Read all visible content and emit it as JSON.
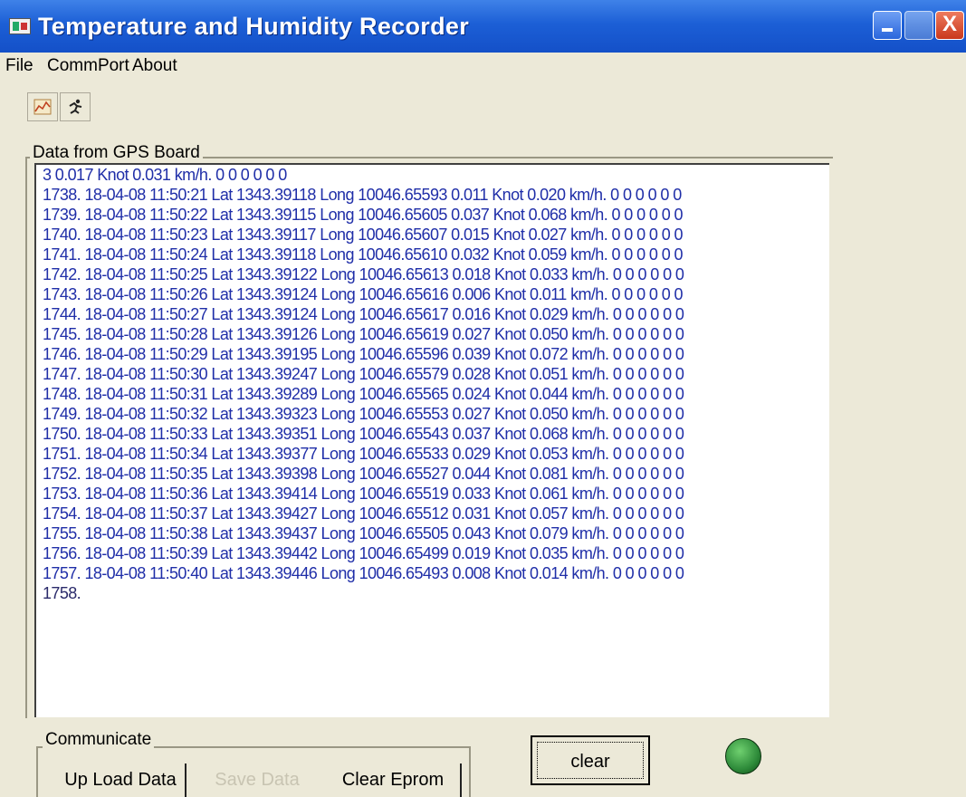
{
  "window": {
    "title": "Temperature and Humidity Recorder",
    "controls": {
      "minimize": "_",
      "maximize": "□",
      "close": "X"
    }
  },
  "menu": {
    "items": [
      {
        "label": "File"
      },
      {
        "label": "CommPort"
      },
      {
        "label": "About"
      }
    ]
  },
  "toolbar": {
    "buttons": [
      {
        "icon": "chart-icon"
      },
      {
        "icon": "runner-icon"
      }
    ]
  },
  "gps_group": {
    "label": "Data from GPS  Board",
    "log_lines": [
      "3  0.017 Knot 0.031 km/h. 0 0 0 0 0 0",
      "1738. 18-04-08 11:50:21 Lat 1343.39118 Long 10046.65593  0.011 Knot 0.020 km/h. 0 0 0 0 0 0",
      "1739. 18-04-08 11:50:22 Lat 1343.39115 Long 10046.65605  0.037 Knot 0.068 km/h. 0 0 0 0 0 0",
      "1740. 18-04-08 11:50:23 Lat 1343.39117 Long 10046.65607  0.015 Knot 0.027 km/h. 0 0 0 0 0 0",
      "1741. 18-04-08 11:50:24 Lat 1343.39118 Long 10046.65610  0.032 Knot 0.059 km/h. 0 0 0 0 0 0",
      "1742. 18-04-08 11:50:25 Lat 1343.39122 Long 10046.65613  0.018 Knot 0.033 km/h. 0 0 0 0 0 0",
      "1743. 18-04-08 11:50:26 Lat 1343.39124 Long 10046.65616  0.006 Knot 0.011 km/h. 0 0 0 0 0 0",
      "1744. 18-04-08 11:50:27 Lat 1343.39124 Long 10046.65617  0.016 Knot 0.029 km/h. 0 0 0 0 0 0",
      "1745. 18-04-08 11:50:28 Lat 1343.39126 Long 10046.65619  0.027 Knot 0.050 km/h. 0 0 0 0 0 0",
      "1746. 18-04-08 11:50:29 Lat 1343.39195 Long 10046.65596  0.039 Knot 0.072 km/h. 0 0 0 0 0 0",
      "1747. 18-04-08 11:50:30 Lat 1343.39247 Long 10046.65579  0.028 Knot 0.051 km/h. 0 0 0 0 0 0",
      "1748. 18-04-08 11:50:31 Lat 1343.39289 Long 10046.65565  0.024 Knot 0.044 km/h. 0 0 0 0 0 0",
      "1749. 18-04-08 11:50:32 Lat 1343.39323 Long 10046.65553  0.027 Knot 0.050 km/h. 0 0 0 0 0 0",
      "1750. 18-04-08 11:50:33 Lat 1343.39351 Long 10046.65543  0.037 Knot 0.068 km/h. 0 0 0 0 0 0",
      "1751. 18-04-08 11:50:34 Lat 1343.39377 Long 10046.65533  0.029 Knot 0.053 km/h. 0 0 0 0 0 0",
      "1752. 18-04-08 11:50:35 Lat 1343.39398 Long 10046.65527  0.044 Knot 0.081 km/h. 0 0 0 0 0 0",
      "1753. 18-04-08 11:50:36 Lat 1343.39414 Long 10046.65519  0.033 Knot 0.061 km/h. 0 0 0 0 0 0",
      "1754. 18-04-08 11:50:37 Lat 1343.39427 Long 10046.65512  0.031 Knot 0.057 km/h. 0 0 0 0 0 0",
      "1755. 18-04-08 11:50:38 Lat 1343.39437 Long 10046.65505  0.043 Knot 0.079 km/h. 0 0 0 0 0 0",
      "1756. 18-04-08 11:50:39 Lat 1343.39442 Long 10046.65499  0.019 Knot 0.035 km/h. 0 0 0 0 0 0",
      "1757. 18-04-08 11:50:40 Lat 1343.39446 Long 10046.65493  0.008 Knot 0.014 km/h. 0 0 0 0 0 0",
      "1758."
    ]
  },
  "communicate_group": {
    "label": "Communicate",
    "buttons": [
      {
        "label": "Up Load Data",
        "enabled": true
      },
      {
        "label": "Save Data",
        "enabled": false
      },
      {
        "label": "Clear Eprom",
        "enabled": true
      }
    ]
  },
  "clear_button": {
    "label": "clear"
  },
  "status_led": {
    "state": "connected",
    "color": "#2e8b3a"
  }
}
